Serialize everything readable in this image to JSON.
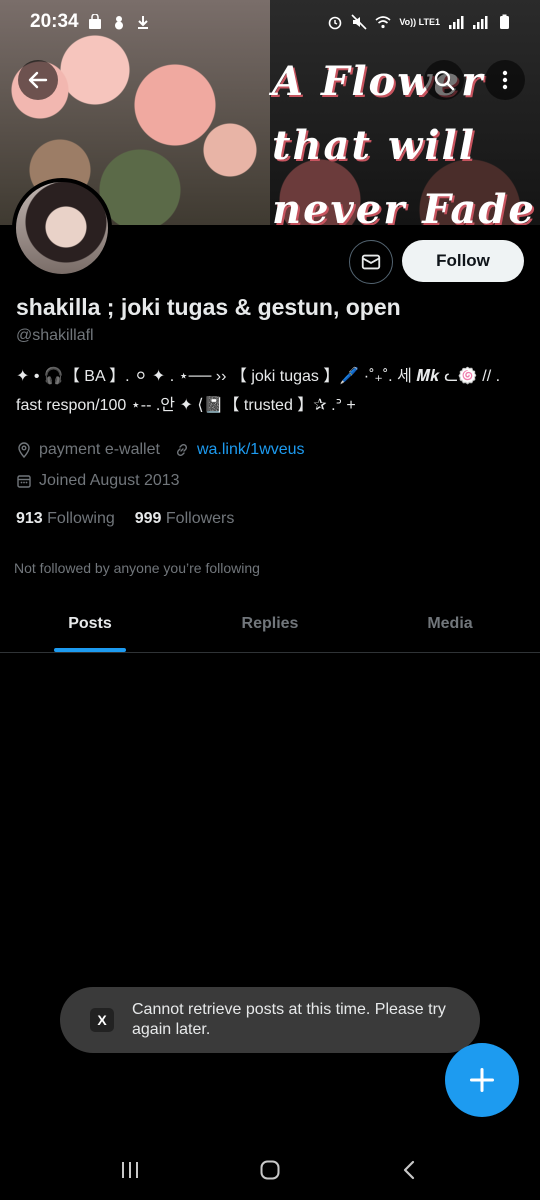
{
  "status_bar": {
    "time": "20:34",
    "network_label": "Vo)) LTE1"
  },
  "banner": {
    "text_lines": [
      "A Flower",
      "that will",
      "never Fade"
    ]
  },
  "header_icons": {
    "back": "arrow-left-icon",
    "search": "search-icon",
    "more": "more-vertical-icon"
  },
  "profile": {
    "message_icon": "envelope-icon",
    "follow_label": "Follow",
    "display_name": "shakilla ; joki tugas & gestun, open",
    "handle": "@shakillafl",
    "bio": "✦ • 🎧【 BA 】. ⚪ ✦ . ⋆── ›› 【 joki tugas 】🖊️ ·˚₊˚. 세 𝑴𝒌 ᓚ🍥 // . fast respon/100 ⋆-- .안 ✦ ⟨📓【 trusted 】✰ .ᐣ +",
    "location": "payment e-wallet",
    "link": "wa.link/1wveus",
    "joined": "Joined August 2013",
    "following_count": "913",
    "following_label": "Following",
    "followers_count": "999",
    "followers_label": "Followers",
    "not_followed": "Not followed by anyone you’re following"
  },
  "tabs": [
    {
      "label": "Posts",
      "active": true
    },
    {
      "label": "Replies",
      "active": false
    },
    {
      "label": "Media",
      "active": false
    }
  ],
  "toast": {
    "icon_label": "X",
    "message": "Cannot retrieve posts at this time. Please try again later."
  },
  "fab": {
    "icon": "plus-icon"
  },
  "nav_bar": {
    "recents": "recents-icon",
    "home": "home-icon",
    "back": "back-chevron-icon"
  },
  "colors": {
    "accent": "#1d9bf0",
    "background": "#000000",
    "secondary_text": "#71767b"
  }
}
